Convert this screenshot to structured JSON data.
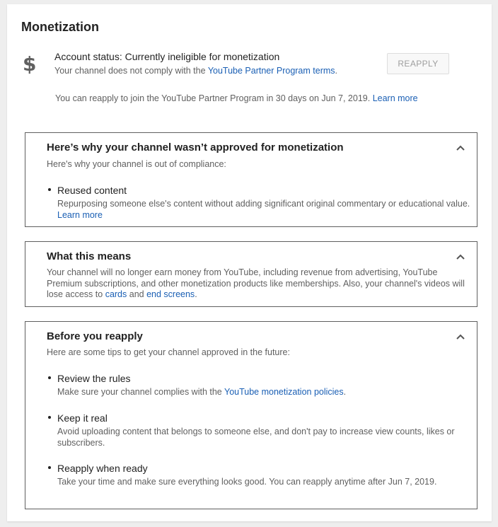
{
  "section": {
    "title": "Monetization",
    "icon": "dollar-icon"
  },
  "status": {
    "headline": "Account status: Currently ineligible for monetization",
    "sub_prefix": "Your channel does not comply with the ",
    "sub_link": "YouTube Partner Program terms",
    "sub_suffix": ".",
    "reapply_button": "REAPPLY",
    "note_text": "You can reapply to join the YouTube Partner Program in 30 days on Jun 7, 2019. ",
    "note_link": "Learn more"
  },
  "panel_why": {
    "title": "Here’s why your channel wasn’t approved for monetization",
    "desc": "Here's why your channel is out of compliance:",
    "items": [
      {
        "title": "Reused content",
        "desc": "Repurposing someone else's content without adding significant original commentary or educational value.  ",
        "link": "Learn more"
      }
    ]
  },
  "panel_means": {
    "title": "What this means",
    "desc_prefix": "Your channel will no longer earn money from YouTube, including revenue from advertising, YouTube Premium subscriptions, and other monetization products like memberships. Also, your channel's videos will lose access to ",
    "link_cards": "cards",
    "desc_and": " and ",
    "link_end_screens": "end screens",
    "desc_suffix": "."
  },
  "panel_before": {
    "title": "Before you reapply",
    "desc": "Here are some tips to get your channel approved in the future:",
    "items": [
      {
        "title": "Review the rules",
        "desc": "Make sure your channel complies with the ",
        "link": "YouTube monetization policies",
        "suffix": "."
      },
      {
        "title": "Keep it real",
        "desc": "Avoid uploading content that belongs to someone else, and don't pay to increase view counts, likes or subscribers."
      },
      {
        "title": "Reapply when ready",
        "desc": "Take your time and make sure everything looks good. You can reapply anytime after Jun 7, 2019."
      }
    ]
  },
  "colors": {
    "link": "#1a5fb4",
    "secondary_text": "#606060",
    "border": "#5f5f5f"
  }
}
